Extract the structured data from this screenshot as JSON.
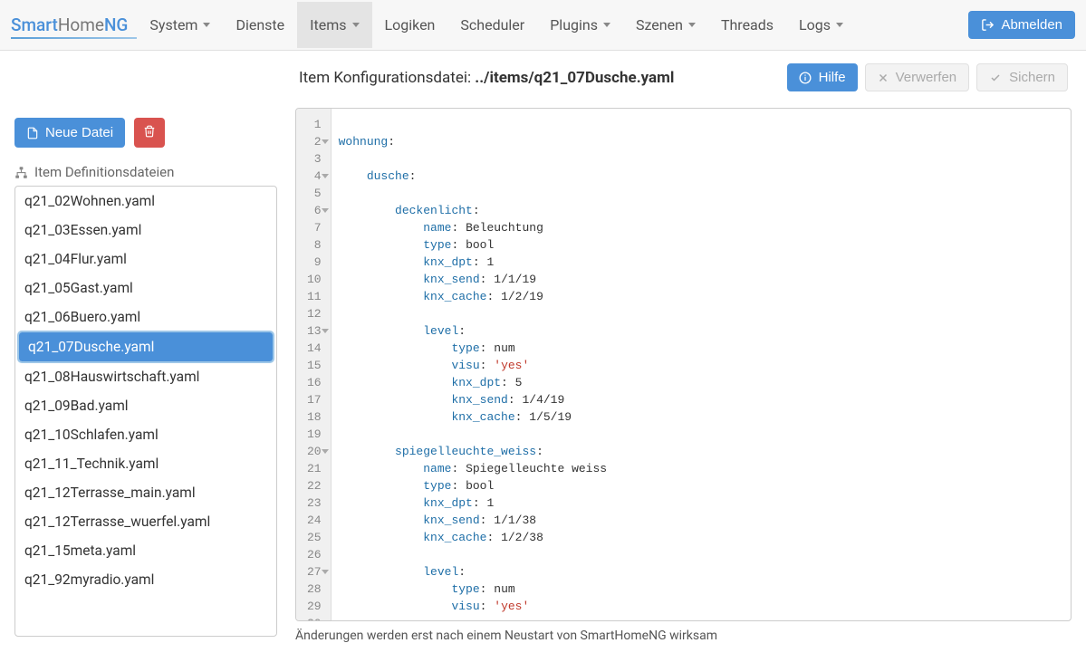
{
  "nav": {
    "brand": {
      "a": "Smart",
      "b": "Home",
      "c": "NG"
    },
    "items": [
      {
        "label": "System",
        "caret": true,
        "active": false
      },
      {
        "label": "Dienste",
        "caret": false,
        "active": false
      },
      {
        "label": "Items",
        "caret": true,
        "active": true
      },
      {
        "label": "Logiken",
        "caret": false,
        "active": false
      },
      {
        "label": "Scheduler",
        "caret": false,
        "active": false
      },
      {
        "label": "Plugins",
        "caret": true,
        "active": false
      },
      {
        "label": "Szenen",
        "caret": true,
        "active": false
      },
      {
        "label": "Threads",
        "caret": false,
        "active": false
      },
      {
        "label": "Logs",
        "caret": true,
        "active": false
      }
    ],
    "logout_label": "Abmelden"
  },
  "sidebar": {
    "new_file_label": "Neue Datei",
    "heading": "Item Definitionsdateien",
    "files": [
      "q21_02Wohnen.yaml",
      "q21_03Essen.yaml",
      "q21_04Flur.yaml",
      "q21_05Gast.yaml",
      "q21_06Buero.yaml",
      "q21_07Dusche.yaml",
      "q21_08Hauswirtschaft.yaml",
      "q21_09Bad.yaml",
      "q21_10Schlafen.yaml",
      "q21_11_Technik.yaml",
      "q21_12Terrasse_main.yaml",
      "q21_12Terrasse_wuerfel.yaml",
      "q21_15meta.yaml",
      "q21_92myradio.yaml"
    ],
    "selected_index": 5
  },
  "header": {
    "title_prefix": "Item Konfigurationsdatei: ",
    "file_path": "../items/q21_07Dusche.yaml",
    "help_label": "Hilfe",
    "discard_label": "Verwerfen",
    "save_label": "Sichern"
  },
  "editor": {
    "line_start": 1,
    "fold_lines": [
      2,
      4,
      6,
      13,
      20,
      27
    ],
    "lines": [
      [],
      [
        {
          "t": "k",
          "x": "wohnung"
        },
        {
          "t": "p",
          "x": ":"
        }
      ],
      [],
      [
        {
          "t": "sp",
          "x": "    "
        },
        {
          "t": "k",
          "x": "dusche"
        },
        {
          "t": "p",
          "x": ":"
        }
      ],
      [],
      [
        {
          "t": "sp",
          "x": "        "
        },
        {
          "t": "k",
          "x": "deckenlicht"
        },
        {
          "t": "p",
          "x": ":"
        }
      ],
      [
        {
          "t": "sp",
          "x": "            "
        },
        {
          "t": "k",
          "x": "name"
        },
        {
          "t": "p",
          "x": ": "
        },
        {
          "t": "v",
          "x": "Beleuchtung"
        }
      ],
      [
        {
          "t": "sp",
          "x": "            "
        },
        {
          "t": "k",
          "x": "type"
        },
        {
          "t": "p",
          "x": ": "
        },
        {
          "t": "v",
          "x": "bool"
        }
      ],
      [
        {
          "t": "sp",
          "x": "            "
        },
        {
          "t": "k",
          "x": "knx_dpt"
        },
        {
          "t": "p",
          "x": ": "
        },
        {
          "t": "v",
          "x": "1"
        }
      ],
      [
        {
          "t": "sp",
          "x": "            "
        },
        {
          "t": "k",
          "x": "knx_send"
        },
        {
          "t": "p",
          "x": ": "
        },
        {
          "t": "v",
          "x": "1/1/19"
        }
      ],
      [
        {
          "t": "sp",
          "x": "            "
        },
        {
          "t": "k",
          "x": "knx_cache"
        },
        {
          "t": "p",
          "x": ": "
        },
        {
          "t": "v",
          "x": "1/2/19"
        }
      ],
      [],
      [
        {
          "t": "sp",
          "x": "            "
        },
        {
          "t": "k",
          "x": "level"
        },
        {
          "t": "p",
          "x": ":"
        }
      ],
      [
        {
          "t": "sp",
          "x": "                "
        },
        {
          "t": "k",
          "x": "type"
        },
        {
          "t": "p",
          "x": ": "
        },
        {
          "t": "v",
          "x": "num"
        }
      ],
      [
        {
          "t": "sp",
          "x": "                "
        },
        {
          "t": "k",
          "x": "visu"
        },
        {
          "t": "p",
          "x": ": "
        },
        {
          "t": "s",
          "x": "'yes'"
        }
      ],
      [
        {
          "t": "sp",
          "x": "                "
        },
        {
          "t": "k",
          "x": "knx_dpt"
        },
        {
          "t": "p",
          "x": ": "
        },
        {
          "t": "v",
          "x": "5"
        }
      ],
      [
        {
          "t": "sp",
          "x": "                "
        },
        {
          "t": "k",
          "x": "knx_send"
        },
        {
          "t": "p",
          "x": ": "
        },
        {
          "t": "v",
          "x": "1/4/19"
        }
      ],
      [
        {
          "t": "sp",
          "x": "                "
        },
        {
          "t": "k",
          "x": "knx_cache"
        },
        {
          "t": "p",
          "x": ": "
        },
        {
          "t": "v",
          "x": "1/5/19"
        }
      ],
      [],
      [
        {
          "t": "sp",
          "x": "        "
        },
        {
          "t": "k",
          "x": "spiegelleuchte_weiss"
        },
        {
          "t": "p",
          "x": ":"
        }
      ],
      [
        {
          "t": "sp",
          "x": "            "
        },
        {
          "t": "k",
          "x": "name"
        },
        {
          "t": "p",
          "x": ": "
        },
        {
          "t": "v",
          "x": "Spiegelleuchte weiss"
        }
      ],
      [
        {
          "t": "sp",
          "x": "            "
        },
        {
          "t": "k",
          "x": "type"
        },
        {
          "t": "p",
          "x": ": "
        },
        {
          "t": "v",
          "x": "bool"
        }
      ],
      [
        {
          "t": "sp",
          "x": "            "
        },
        {
          "t": "k",
          "x": "knx_dpt"
        },
        {
          "t": "p",
          "x": ": "
        },
        {
          "t": "v",
          "x": "1"
        }
      ],
      [
        {
          "t": "sp",
          "x": "            "
        },
        {
          "t": "k",
          "x": "knx_send"
        },
        {
          "t": "p",
          "x": ": "
        },
        {
          "t": "v",
          "x": "1/1/38"
        }
      ],
      [
        {
          "t": "sp",
          "x": "            "
        },
        {
          "t": "k",
          "x": "knx_cache"
        },
        {
          "t": "p",
          "x": ": "
        },
        {
          "t": "v",
          "x": "1/2/38"
        }
      ],
      [],
      [
        {
          "t": "sp",
          "x": "            "
        },
        {
          "t": "k",
          "x": "level"
        },
        {
          "t": "p",
          "x": ":"
        }
      ],
      [
        {
          "t": "sp",
          "x": "                "
        },
        {
          "t": "k",
          "x": "type"
        },
        {
          "t": "p",
          "x": ": "
        },
        {
          "t": "v",
          "x": "num"
        }
      ],
      [
        {
          "t": "sp",
          "x": "                "
        },
        {
          "t": "k",
          "x": "visu"
        },
        {
          "t": "p",
          "x": ": "
        },
        {
          "t": "s",
          "x": "'yes'"
        }
      ],
      []
    ]
  },
  "footer": {
    "note": "Änderungen werden erst nach einem Neustart von SmartHomeNG wirksam"
  }
}
